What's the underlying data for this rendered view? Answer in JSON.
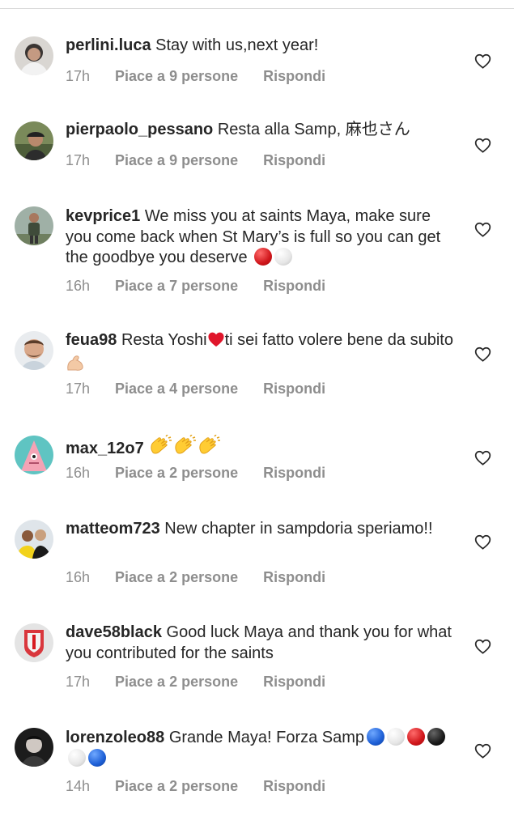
{
  "comments": [
    {
      "username": "perlini.luca",
      "text": "Stay with us,next year!",
      "time": "17h",
      "likes": "Piace a 9 persone",
      "reply": "Rispondi"
    },
    {
      "username": "pierpaolo_pessano",
      "text": "Resta alla Samp, 麻也さん",
      "time": "17h",
      "likes": "Piace a 9 persone",
      "reply": "Rispondi"
    },
    {
      "username": "kevprice1",
      "text": "We miss you at saints Maya, make sure you come back when St Mary’s is full so you can get the goodbye you deserve",
      "time": "16h",
      "likes": "Piace a 7 persone",
      "reply": "Rispondi"
    },
    {
      "username": "feua98",
      "text_a": "Resta Yoshi",
      "text_b": "ti sei fatto volere bene da subito",
      "time": "17h",
      "likes": "Piace a 4 persone",
      "reply": "Rispondi"
    },
    {
      "username": "max_12o7",
      "text": "",
      "time": "16h",
      "likes": "Piace a 2 persone",
      "reply": "Rispondi"
    },
    {
      "username": "matteom723",
      "text": "New chapter in sampdoria speriamo!!",
      "time": "16h",
      "likes": "Piace a 2 persone",
      "reply": "Rispondi"
    },
    {
      "username": "dave58black",
      "text": "Good luck Maya and thank you for what you contributed for the saints",
      "time": "17h",
      "likes": "Piace a 2 persone",
      "reply": "Rispondi"
    },
    {
      "username": "lorenzoleo88",
      "text": "Grande Maya! Forza Samp",
      "time": "14h",
      "likes": "Piace a 2 persone",
      "reply": "Rispondi"
    }
  ],
  "colors": {
    "text": "#262626",
    "muted": "#8e8e8e",
    "divider": "#dbdbdb",
    "heart_icon": "#262626"
  },
  "icons": {
    "like": "heart-outline-icon",
    "clap": "clapping-hands-emoji",
    "heart": "red-heart-emoji",
    "muscle": "flexed-biceps-emoji"
  }
}
